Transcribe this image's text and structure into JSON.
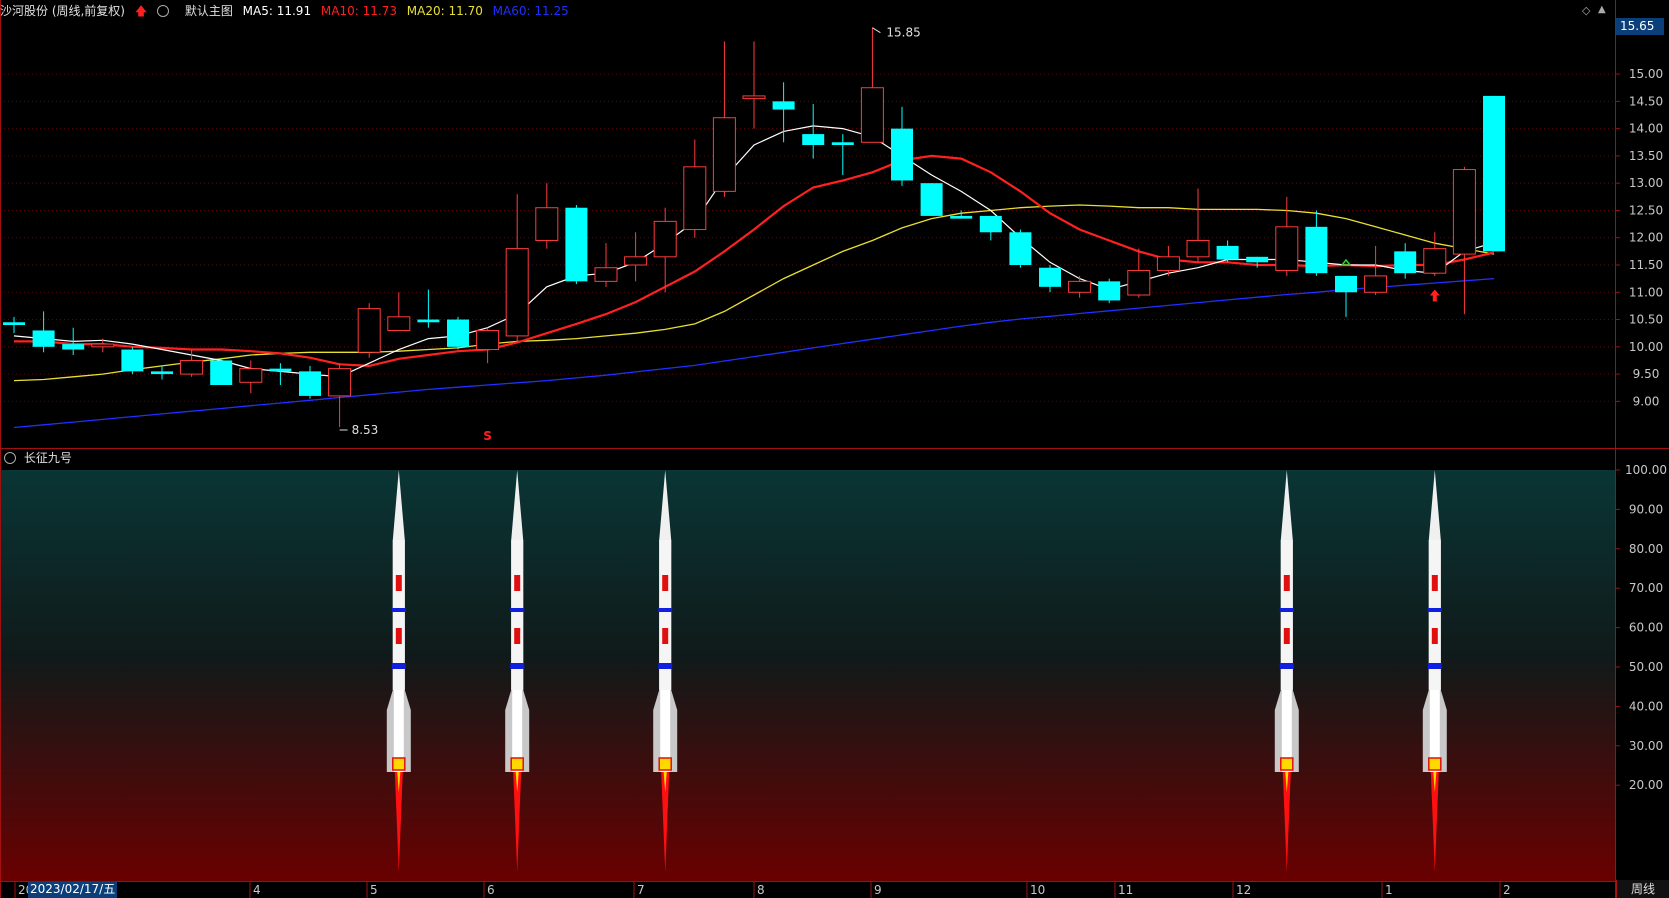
{
  "header": {
    "stock_title": "沙河股份 (周线,前复权)",
    "main_chart_label": "默认主图",
    "ma5": "MA5: 11.91",
    "ma10": "MA10: 11.73",
    "ma20": "MA20: 11.70",
    "ma60": "MA60: 11.25",
    "current_price": "15.65"
  },
  "colors": {
    "up": "#ff3b3b",
    "down": "#00ffff",
    "ma5": "#ffffff",
    "ma10": "#ff2020",
    "ma20": "#e8e030",
    "ma60": "#2030ff",
    "axis": "#a01010"
  },
  "main_axis": {
    "ticks": [
      "15.00",
      "14.50",
      "14.00",
      "13.50",
      "13.00",
      "12.50",
      "12.00",
      "11.50",
      "11.00",
      "10.50",
      "10.00",
      "9.50",
      "9.00"
    ],
    "high_mark": "15.85",
    "low_mark": "8.53",
    "s_mark": "S"
  },
  "sub_panel": {
    "title": "长征九号",
    "ticks": [
      "100.00",
      "90.00",
      "80.00",
      "70.00",
      "60.00",
      "50.00",
      "40.00",
      "30.00",
      "20.00"
    ],
    "rocket_bars": [
      13,
      17,
      22,
      43,
      48
    ]
  },
  "x_axis": {
    "labels": [
      "20",
      "4",
      "5",
      "6",
      "7",
      "8",
      "9",
      "10",
      "11",
      "12",
      "1",
      "2"
    ],
    "cursor_date": "2023/02/17/五",
    "period_label": "周线"
  },
  "chart_data": {
    "type": "candlestick",
    "ylim": [
      8.2,
      15.9
    ],
    "candles": [
      [
        10.45,
        10.4,
        10.55,
        10.25
      ],
      [
        10.3,
        10.0,
        10.65,
        9.9
      ],
      [
        10.05,
        9.95,
        10.35,
        9.85
      ],
      [
        10.0,
        10.05,
        10.15,
        9.9
      ],
      [
        9.95,
        9.55,
        10.0,
        9.5
      ],
      [
        9.55,
        9.5,
        9.65,
        9.4
      ],
      [
        9.5,
        9.75,
        9.95,
        9.45
      ],
      [
        9.75,
        9.3,
        9.8,
        9.3
      ],
      [
        9.35,
        9.6,
        9.75,
        9.15
      ],
      [
        9.6,
        9.55,
        9.7,
        9.3
      ],
      [
        9.55,
        9.1,
        9.65,
        9.05
      ],
      [
        9.1,
        9.6,
        9.7,
        8.53
      ],
      [
        9.9,
        10.7,
        10.8,
        9.8
      ],
      [
        10.3,
        10.55,
        11.0,
        10.35
      ],
      [
        10.5,
        10.45,
        11.05,
        10.35
      ],
      [
        10.5,
        10.0,
        10.55,
        9.95
      ],
      [
        9.95,
        10.3,
        10.35,
        9.7
      ],
      [
        10.2,
        11.8,
        12.8,
        10.1
      ],
      [
        11.95,
        12.55,
        13.0,
        11.8
      ],
      [
        12.55,
        11.2,
        12.6,
        11.15
      ],
      [
        11.2,
        11.45,
        11.9,
        11.1
      ],
      [
        11.5,
        11.65,
        12.1,
        11.2
      ],
      [
        11.65,
        12.3,
        12.55,
        11.0
      ],
      [
        12.15,
        13.3,
        13.8,
        12.0
      ],
      [
        12.85,
        14.2,
        15.6,
        12.75
      ],
      [
        14.55,
        14.6,
        15.6,
        14.0
      ],
      [
        14.5,
        14.35,
        14.85,
        13.75
      ],
      [
        13.9,
        13.7,
        14.45,
        13.45
      ],
      [
        13.75,
        13.7,
        13.9,
        13.15
      ],
      [
        13.75,
        14.75,
        15.85,
        13.75
      ],
      [
        14.0,
        13.05,
        14.4,
        12.95
      ],
      [
        13.0,
        12.4,
        13.0,
        12.4
      ],
      [
        12.4,
        12.35,
        12.5,
        12.35
      ],
      [
        12.4,
        12.1,
        12.4,
        11.95
      ],
      [
        12.1,
        11.5,
        12.15,
        11.45
      ],
      [
        11.45,
        11.1,
        11.5,
        11.0
      ],
      [
        11.0,
        11.2,
        11.3,
        10.9
      ],
      [
        11.2,
        10.85,
        11.25,
        10.8
      ],
      [
        10.95,
        11.4,
        11.8,
        10.9
      ],
      [
        11.4,
        11.65,
        11.85,
        11.3
      ],
      [
        11.65,
        11.95,
        12.9,
        11.55
      ],
      [
        11.85,
        11.6,
        11.95,
        11.55
      ],
      [
        11.65,
        11.55,
        11.65,
        11.45
      ],
      [
        11.4,
        12.2,
        12.75,
        11.3
      ],
      [
        12.2,
        11.35,
        12.5,
        11.3
      ],
      [
        11.3,
        11.0,
        11.3,
        10.55
      ],
      [
        11.0,
        11.3,
        11.85,
        10.95
      ],
      [
        11.75,
        11.35,
        11.9,
        11.25
      ],
      [
        11.35,
        11.8,
        12.1,
        11.3
      ],
      [
        11.7,
        13.25,
        13.3,
        10.6
      ],
      [
        14.6,
        11.75,
        14.6,
        11.75
      ]
    ],
    "ma5": [
      10.2,
      10.15,
      10.1,
      10.12,
      10.05,
      9.95,
      9.85,
      9.75,
      9.6,
      9.55,
      9.5,
      9.45,
      9.7,
      9.95,
      10.15,
      10.2,
      10.35,
      10.6,
      11.1,
      11.3,
      11.35,
      11.55,
      11.9,
      12.3,
      13.1,
      13.7,
      13.95,
      14.05,
      14.0,
      13.85,
      13.5,
      13.15,
      12.85,
      12.5,
      12.0,
      11.55,
      11.25,
      11.05,
      11.2,
      11.35,
      11.45,
      11.6,
      11.6,
      11.6,
      11.55,
      11.5,
      11.5,
      11.4,
      11.35,
      11.75,
      11.91
    ],
    "ma10": [
      10.1,
      10.1,
      10.05,
      10.05,
      10.0,
      9.98,
      9.95,
      9.95,
      9.92,
      9.88,
      9.8,
      9.68,
      9.65,
      9.78,
      9.85,
      9.92,
      9.95,
      10.08,
      10.25,
      10.42,
      10.6,
      10.82,
      11.1,
      11.38,
      11.75,
      12.15,
      12.58,
      12.92,
      13.05,
      13.2,
      13.42,
      13.5,
      13.45,
      13.2,
      12.85,
      12.45,
      12.15,
      11.95,
      11.75,
      11.6,
      11.55,
      11.55,
      11.5,
      11.5,
      11.48,
      11.5,
      11.48,
      11.5,
      11.5,
      11.6,
      11.73
    ],
    "ma20": [
      9.38,
      9.4,
      9.45,
      9.5,
      9.58,
      9.65,
      9.72,
      9.78,
      9.85,
      9.88,
      9.9,
      9.9,
      9.9,
      9.92,
      9.95,
      9.98,
      10.05,
      10.1,
      10.12,
      10.15,
      10.2,
      10.25,
      10.32,
      10.42,
      10.65,
      10.95,
      11.25,
      11.5,
      11.75,
      11.95,
      12.18,
      12.35,
      12.45,
      12.5,
      12.55,
      12.58,
      12.6,
      12.58,
      12.55,
      12.55,
      12.52,
      12.52,
      12.52,
      12.5,
      12.45,
      12.35,
      12.2,
      12.05,
      11.9,
      11.8,
      11.7
    ],
    "ma60": [
      8.52,
      8.57,
      8.62,
      8.67,
      8.72,
      8.77,
      8.82,
      8.87,
      8.92,
      8.97,
      9.02,
      9.07,
      9.12,
      9.17,
      9.22,
      9.26,
      9.3,
      9.34,
      9.38,
      9.43,
      9.48,
      9.54,
      9.6,
      9.66,
      9.74,
      9.82,
      9.9,
      9.98,
      10.06,
      10.14,
      10.22,
      10.3,
      10.38,
      10.45,
      10.51,
      10.56,
      10.61,
      10.66,
      10.71,
      10.76,
      10.81,
      10.86,
      10.91,
      10.96,
      11.0,
      11.05,
      11.09,
      11.13,
      11.17,
      11.21,
      11.25
    ]
  }
}
